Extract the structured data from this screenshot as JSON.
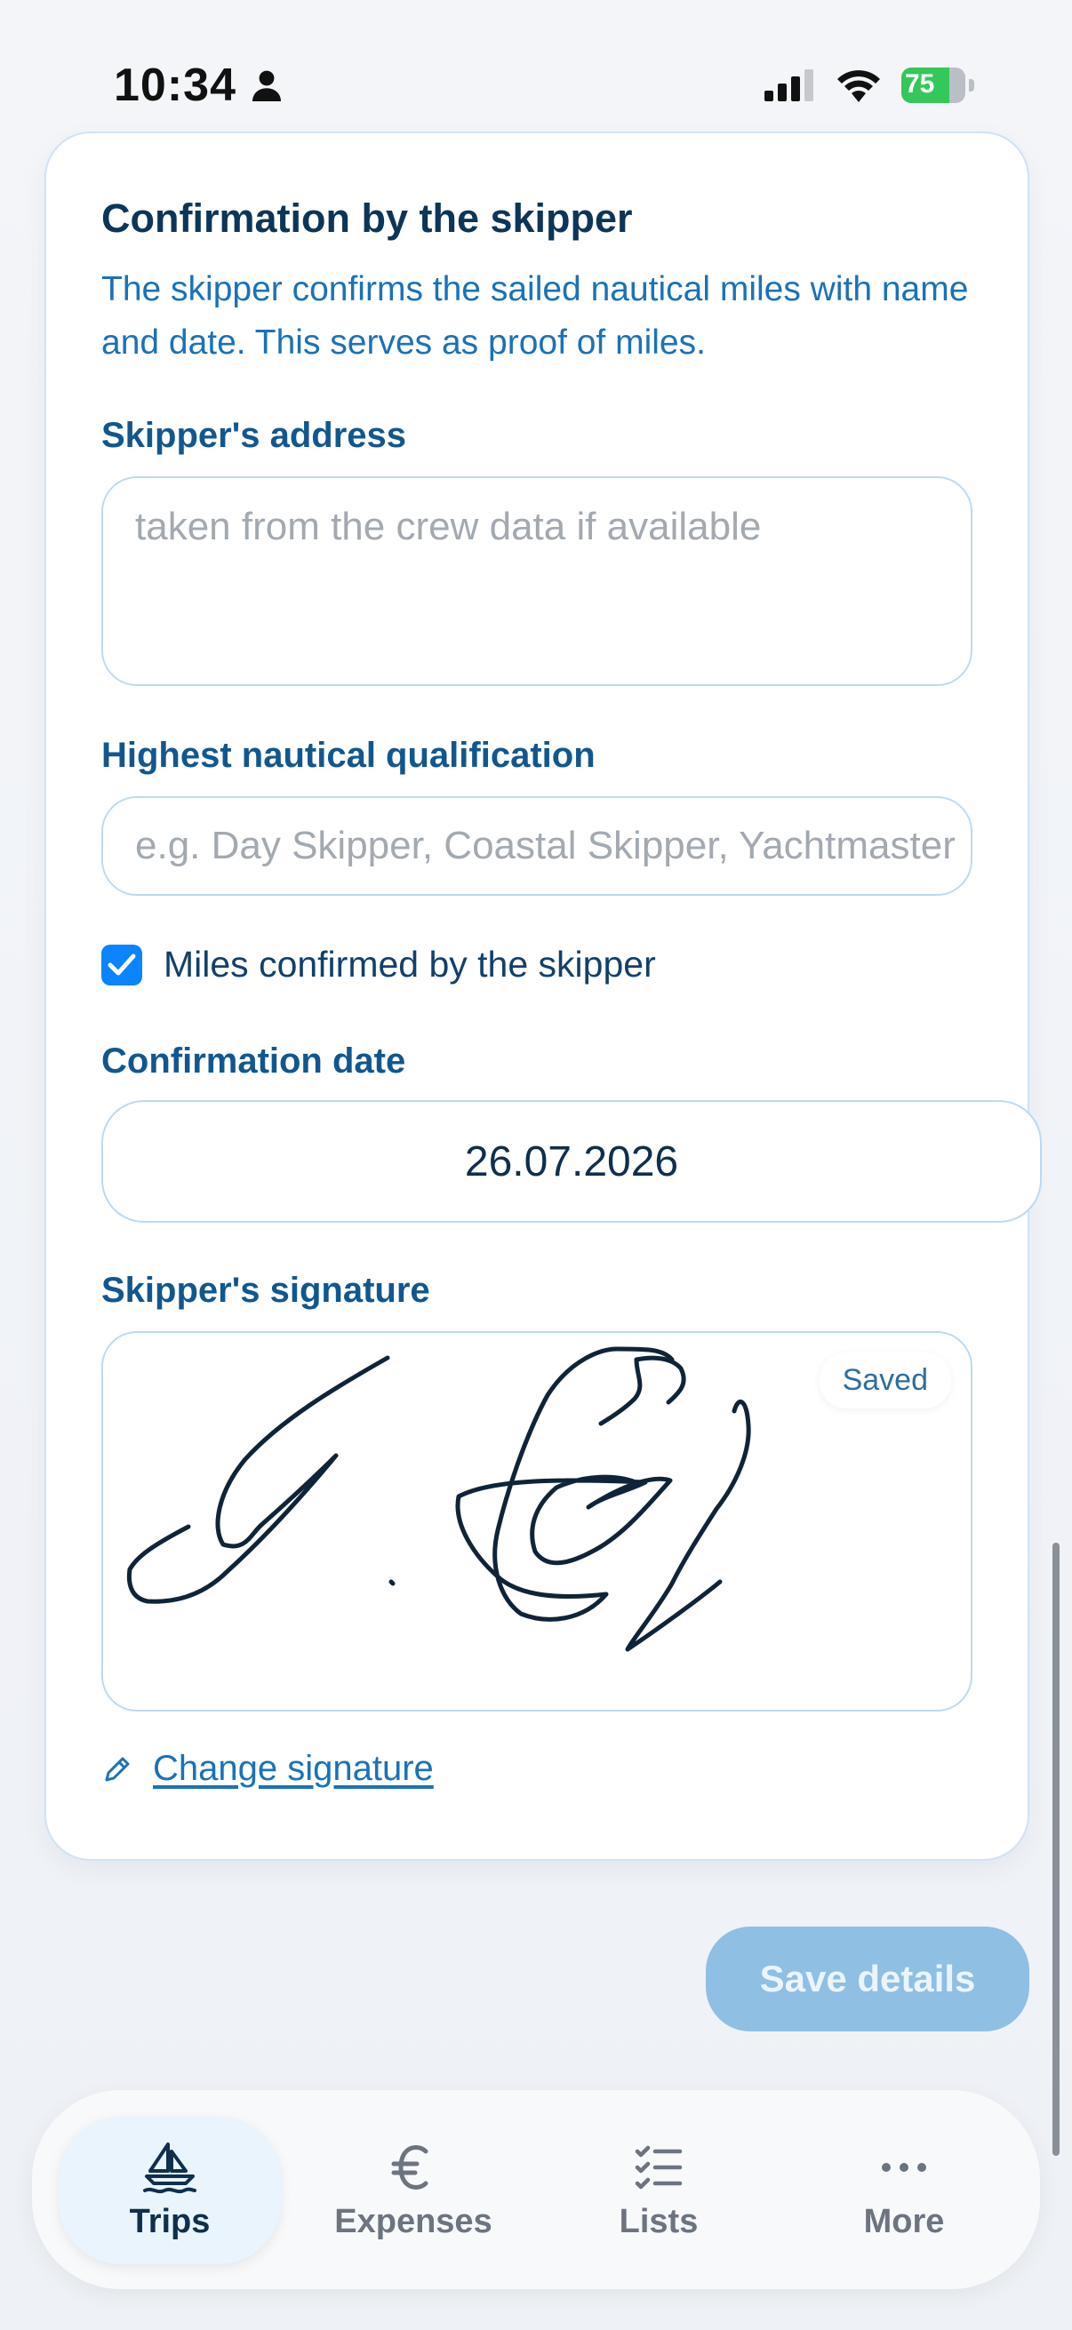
{
  "status_bar": {
    "time": "10:34",
    "battery": "75",
    "battery_level": 0.75
  },
  "section": {
    "title": "Confirmation by the skipper",
    "description": "The skipper confirms the sailed nautical miles with name and date. This serves as proof of miles."
  },
  "address": {
    "label": "Skipper's address",
    "placeholder": "taken from the crew data if available",
    "value": ""
  },
  "qualification": {
    "label": "Highest nautical qualification",
    "placeholder": "e.g. Day Skipper, Coastal Skipper, Yachtmaster",
    "value": ""
  },
  "confirmed": {
    "label": "Miles confirmed by the skipper",
    "checked": true
  },
  "confirmation_date": {
    "label": "Confirmation date",
    "value": "26.07.2026"
  },
  "signature": {
    "label": "Skipper's signature",
    "badge": "Saved",
    "change_label": "Change signature"
  },
  "save_button": {
    "label": "Save details"
  },
  "tabs": [
    {
      "label": "Trips",
      "icon": "sailboat-icon",
      "active": true
    },
    {
      "label": "Expenses",
      "icon": "euro-icon",
      "active": false
    },
    {
      "label": "Lists",
      "icon": "checklist-icon",
      "active": false
    },
    {
      "label": "More",
      "icon": "more-icon",
      "active": false
    }
  ],
  "colors": {
    "accent": "#0a84ff",
    "link": "#1a72b8",
    "title": "#0c3558",
    "save_disabled": "#8fbfe3",
    "battery": "#34c759"
  }
}
